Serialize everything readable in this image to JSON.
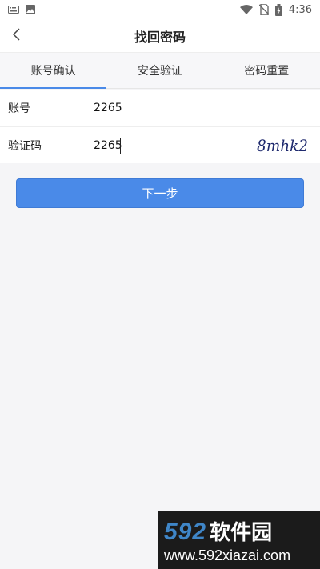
{
  "status_bar": {
    "time": "4:36",
    "icons": [
      "keyboard-icon",
      "image-icon",
      "wifi-icon",
      "no-sim-icon",
      "battery-icon"
    ]
  },
  "header": {
    "title": "找回密码",
    "back_icon": "chevron-left-icon"
  },
  "tabs": [
    {
      "label": "账号确认",
      "active": true
    },
    {
      "label": "安全验证",
      "active": false
    },
    {
      "label": "密码重置",
      "active": false
    }
  ],
  "form": {
    "account": {
      "label": "账号",
      "value": "2265"
    },
    "captcha": {
      "label": "验证码",
      "value": "2265",
      "image_text": "8mhk2"
    }
  },
  "next_button": {
    "label": "下一步"
  },
  "watermark": {
    "brand_num": "592",
    "brand_cn": "软件园",
    "url": "www.592xiazai.com"
  },
  "colors": {
    "accent": "#4a8ae8",
    "background": "#f5f5f7",
    "captcha_ink": "#1f2a6e"
  }
}
